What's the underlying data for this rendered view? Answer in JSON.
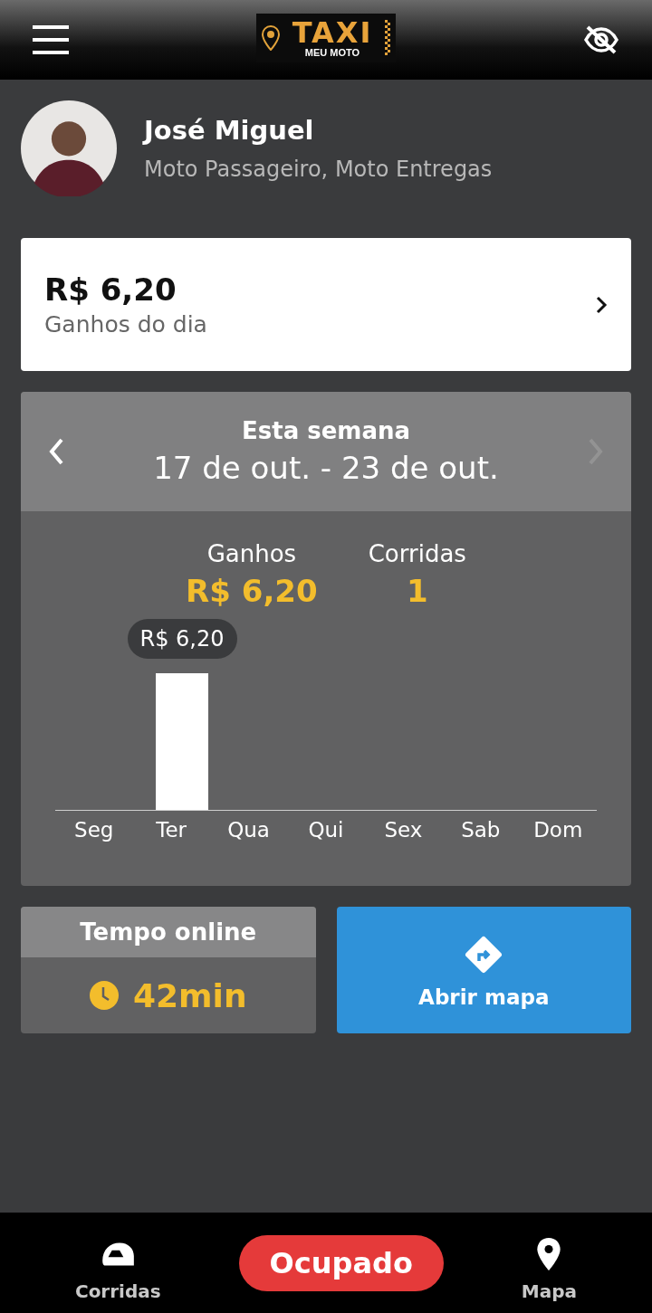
{
  "header": {
    "logo": {
      "word": "TAXI",
      "subword": "MEU MOTO"
    }
  },
  "profile": {
    "name": "José Miguel",
    "services": "Moto Passageiro, Moto Entregas"
  },
  "daily": {
    "amount": "R$ 6,20",
    "label": "Ganhos do dia"
  },
  "week": {
    "title": "Esta semana",
    "range": "17 de out. - 23 de out.",
    "prev_disabled": false,
    "next_disabled": true,
    "stats": [
      {
        "label": "Ganhos",
        "value": "R$ 6,20"
      },
      {
        "label": "Corridas",
        "value": "1"
      }
    ],
    "chart_data": {
      "type": "bar",
      "categories": [
        "Seg",
        "Ter",
        "Qua",
        "Qui",
        "Sex",
        "Sab",
        "Dom"
      ],
      "values": [
        0,
        6.2,
        0,
        0,
        0,
        0,
        0
      ],
      "value_labels": [
        null,
        "R$ 6,20",
        null,
        null,
        null,
        null,
        null
      ]
    }
  },
  "online": {
    "title": "Tempo online",
    "value": "42min"
  },
  "map_button": {
    "label": "Abrir mapa"
  },
  "bottom_nav": {
    "items": [
      {
        "kind": "rides",
        "label": "Corridas"
      },
      {
        "kind": "status",
        "label": "Ocupado"
      },
      {
        "kind": "map",
        "label": "Mapa"
      }
    ]
  }
}
